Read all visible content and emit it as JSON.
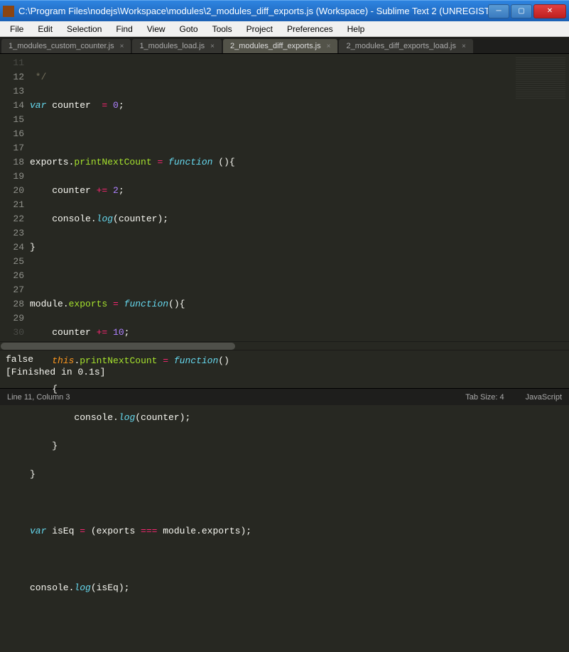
{
  "window": {
    "title": "C:\\Program Files\\nodejs\\Workspace\\modules\\2_modules_diff_exports.js (Workspace) - Sublime Text 2 (UNREGIST..."
  },
  "menu": {
    "items": [
      "File",
      "Edit",
      "Selection",
      "Find",
      "View",
      "Goto",
      "Tools",
      "Project",
      "Preferences",
      "Help"
    ]
  },
  "tabs": [
    {
      "label": "1_modules_custom_counter.js",
      "active": false
    },
    {
      "label": "1_modules_load.js",
      "active": false
    },
    {
      "label": "2_modules_diff_exports.js",
      "active": true
    },
    {
      "label": "2_modules_diff_exports_load.js",
      "active": false
    }
  ],
  "gutter": {
    "start": 11,
    "end": 30
  },
  "code": {
    "l11": " */",
    "l12_var": "var",
    "l12_name": " counter  ",
    "l12_eq": "= ",
    "l12_num": "0",
    "l12_semi": ";",
    "l14_exports": "exports",
    "l14_dot": ".",
    "l14_name": "printNextCount",
    "l14_eq": " = ",
    "l14_fn": "function",
    "l14_rest": " (){",
    "l15_a": "    counter ",
    "l15_op": "+=",
    "l15_sp": " ",
    "l15_num": "2",
    "l15_semi": ";",
    "l16_a": "    console",
    "l16_dot": ".",
    "l16_log": "log",
    "l16_rest": "(counter);",
    "l17": "}",
    "l19_a": "module",
    "l19_dot": ".",
    "l19_exp": "exports",
    "l19_eq": " = ",
    "l19_fn": "function",
    "l19_rest": "(){",
    "l20_a": "    counter ",
    "l20_op": "+=",
    "l20_sp": " ",
    "l20_num": "10",
    "l20_semi": ";",
    "l21_a": "    ",
    "l21_this": "this",
    "l21_dot": ".",
    "l21_name": "printNextCount",
    "l21_eq": " = ",
    "l21_fn": "function",
    "l21_rest": "()",
    "l22": "    {",
    "l23_a": "        console",
    "l23_dot": ".",
    "l23_log": "log",
    "l23_rest": "(counter);",
    "l24": "    }",
    "l25": "}",
    "l27_var": "var",
    "l27_a": " isEq ",
    "l27_eq": "=",
    "l27_b": " (exports ",
    "l27_op": "===",
    "l27_c": " module.exports);",
    "l29_a": "console",
    "l29_dot": ".",
    "l29_log": "log",
    "l29_rest": "(isEq);"
  },
  "console": {
    "line1": "false",
    "line2": "[Finished in 0.1s]"
  },
  "status": {
    "position": "Line 11, Column 3",
    "tabsize": "Tab Size: 4",
    "syntax": "JavaScript"
  }
}
